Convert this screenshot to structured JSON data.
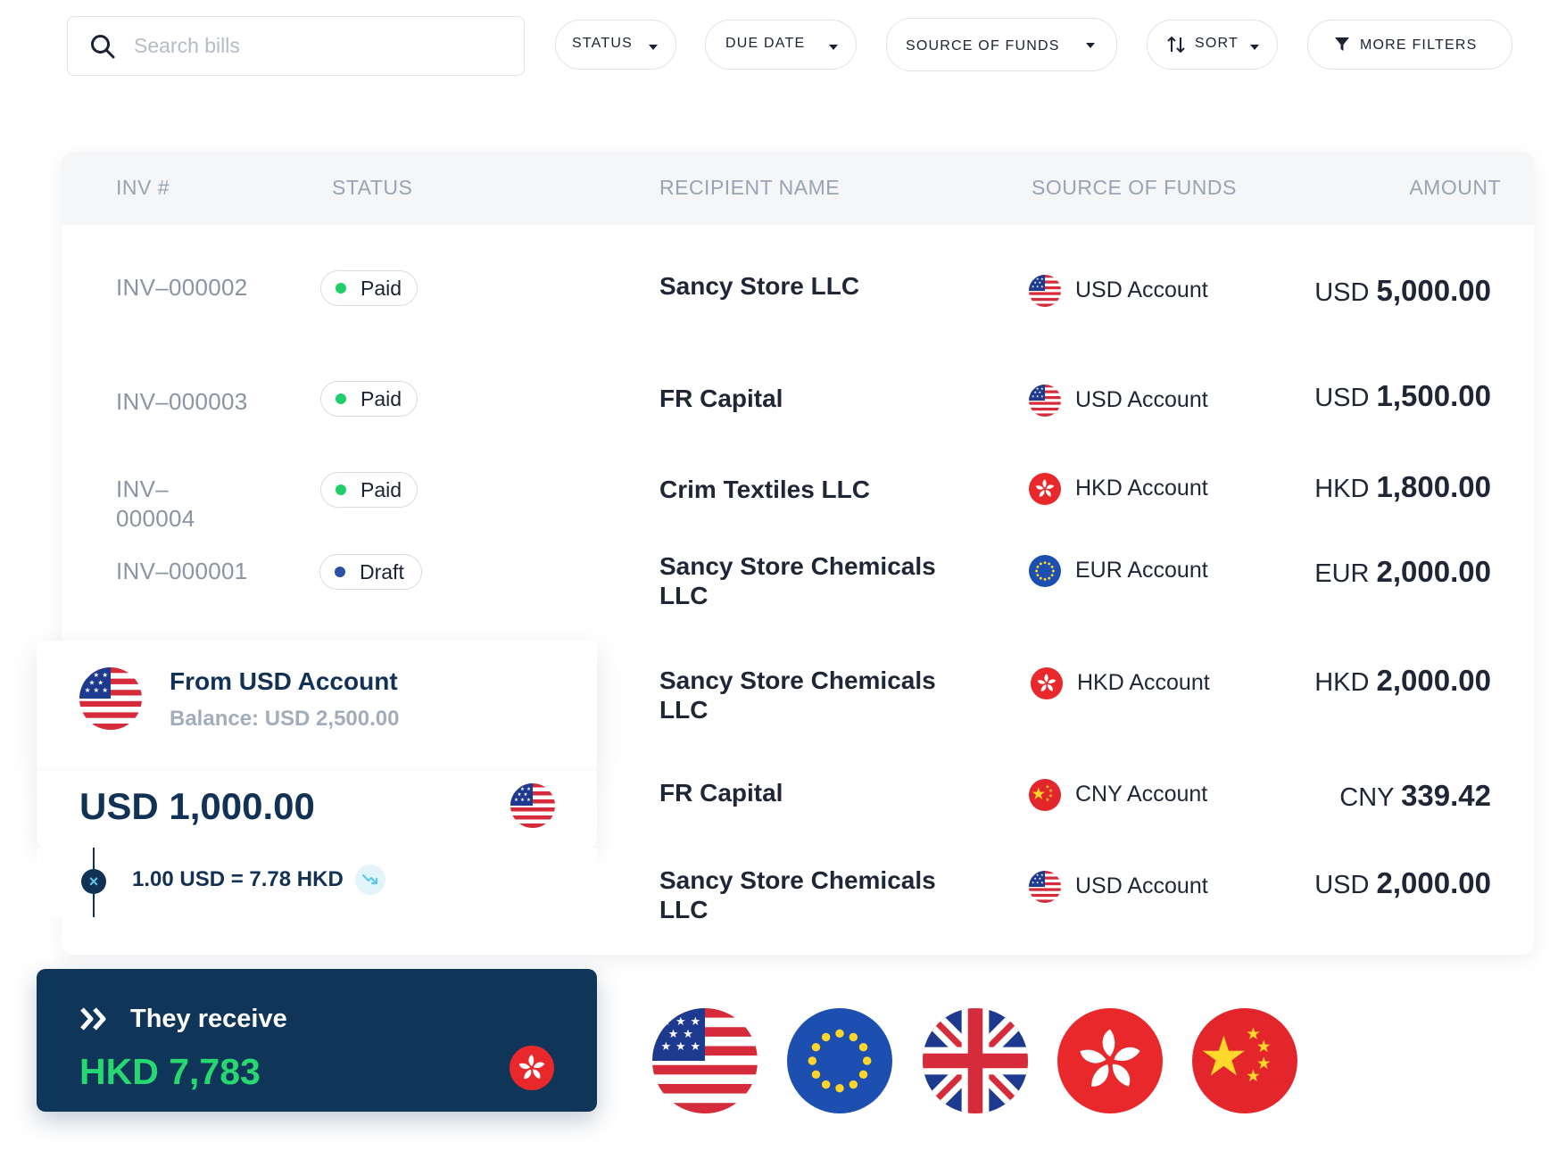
{
  "search": {
    "placeholder": "Search bills"
  },
  "filters": {
    "status": "STATUS",
    "due_date": "DUE DATE",
    "source_of_funds": "SOURCE OF FUNDS",
    "sort": "SORT",
    "more_filters": "MORE FILTERS"
  },
  "table": {
    "headers": {
      "inv": "INV #",
      "status": "STATUS",
      "recipient": "RECIPIENT NAME",
      "source": "SOURCE OF FUNDS",
      "amount": "AMOUNT"
    },
    "rows": [
      {
        "inv": "INV–000002",
        "status": "Paid",
        "recipient": "Sancy Store LLC",
        "flag": "us-flag-icon",
        "source": "USD Account",
        "currency": "USD",
        "amount": "5,000.00"
      },
      {
        "inv": "INV–000003",
        "status": "Paid",
        "recipient": "FR Capital",
        "flag": "us-flag-icon",
        "source": "USD Account",
        "currency": "USD",
        "amount": "1,500.00"
      },
      {
        "inv_line1": "INV–",
        "inv_line2": "000004",
        "status": "Paid",
        "recipient": "Crim Textiles LLC",
        "flag": "hk-flag-icon",
        "source": "HKD Account",
        "currency": "HKD",
        "amount": "1,800.00"
      },
      {
        "inv": "INV–000001",
        "status": "Draft",
        "recipient_line1": "Sancy Store Chemicals",
        "recipient_line2": "LLC",
        "flag": "eu-flag-icon",
        "source": "EUR Account",
        "currency": "EUR",
        "amount": "2,000.00"
      },
      {
        "recipient_line1": "Sancy Store Chemicals",
        "recipient_line2": "LLC",
        "flag": "hk-flag-icon",
        "source": "HKD Account",
        "currency": "HKD",
        "amount": "2,000.00"
      },
      {
        "recipient": "FR Capital",
        "flag": "cn-flag-icon",
        "source": "CNY Account",
        "currency": "CNY",
        "amount": "339.42"
      },
      {
        "recipient_line1": "Sancy Store Chemicals",
        "recipient_line2": "LLC",
        "flag": "us-flag-icon",
        "source": "USD Account",
        "currency": "USD",
        "amount": "2,000.00"
      }
    ]
  },
  "converter": {
    "from_title": "From USD Account",
    "from_balance": "Balance: USD 2,500.00",
    "send_amount": "USD 1,000.00",
    "rate": "1.00 USD = 7.78 HKD",
    "receive_label": "They receive",
    "receive_amount": "HKD 7,783"
  },
  "flags": [
    "us-flag-icon",
    "eu-flag-icon",
    "uk-flag-icon",
    "hk-flag-icon",
    "cn-flag-icon"
  ],
  "colors": {
    "navy": "#0f3558",
    "paid_dot": "#1fcf6a",
    "draft_dot": "#2d4fa8",
    "receive_green": "#27d76f",
    "header_text": "#98a4b3"
  }
}
